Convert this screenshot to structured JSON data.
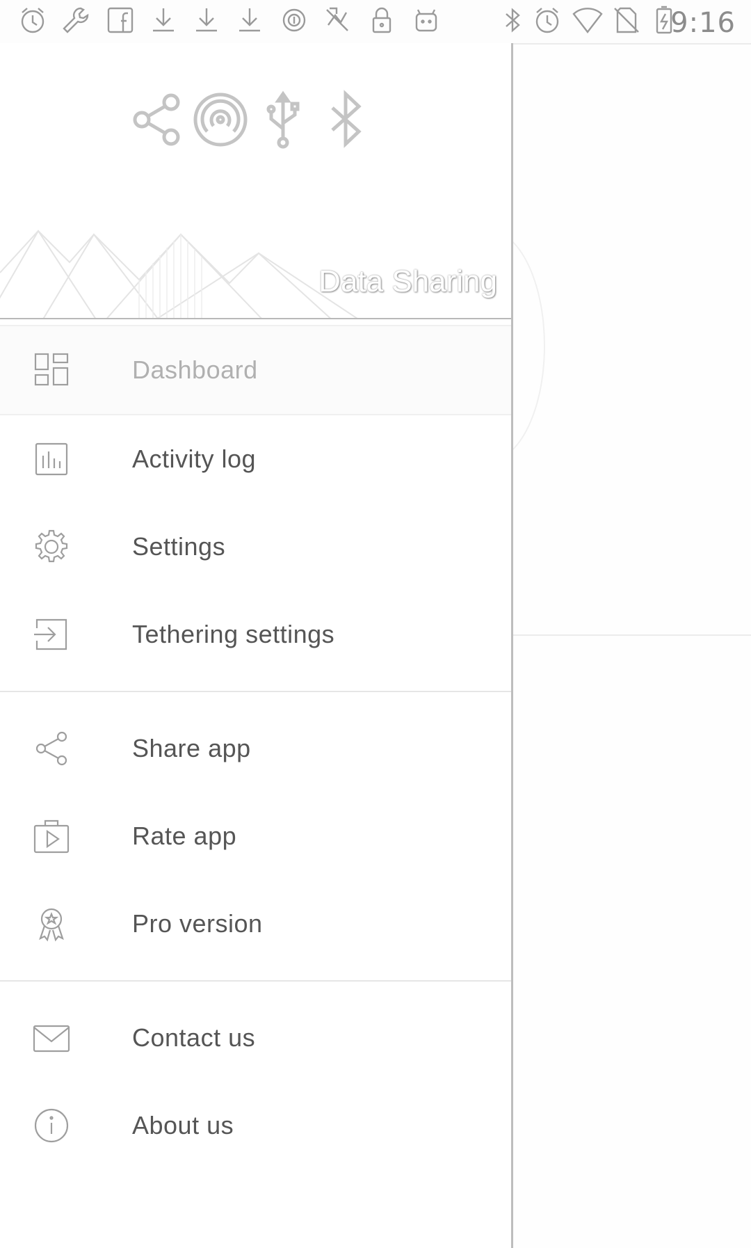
{
  "status_bar": {
    "left_icons": [
      "alarm-icon",
      "wrench-icon",
      "facebook-icon",
      "download-icon",
      "download-icon",
      "download-icon",
      "circle-icon",
      "no-signal-icon",
      "lock-icon",
      "android-icon"
    ],
    "right_icons": [
      "bluetooth-icon",
      "alarm-icon",
      "wifi-icon",
      "no-sim-icon",
      "battery-charging-icon"
    ],
    "time": "9:16"
  },
  "drawer": {
    "header": {
      "icons": [
        "share-icon",
        "hotspot-icon",
        "usb-icon",
        "bluetooth-icon"
      ],
      "title": "Data Sharing"
    },
    "sections": [
      {
        "items": [
          {
            "label": "Dashboard",
            "icon": "dashboard-icon",
            "active": true
          },
          {
            "label": "Activity log",
            "icon": "bar-chart-icon"
          },
          {
            "label": "Settings",
            "icon": "gear-icon"
          },
          {
            "label": "Tethering settings",
            "icon": "login-arrow-icon"
          }
        ]
      },
      {
        "items": [
          {
            "label": "Share app",
            "icon": "share-icon"
          },
          {
            "label": "Rate app",
            "icon": "play-store-icon"
          },
          {
            "label": "Pro version",
            "icon": "award-icon"
          }
        ]
      },
      {
        "items": [
          {
            "label": "Contact us",
            "icon": "mail-icon"
          },
          {
            "label": "About us",
            "icon": "info-icon"
          }
        ]
      }
    ]
  }
}
